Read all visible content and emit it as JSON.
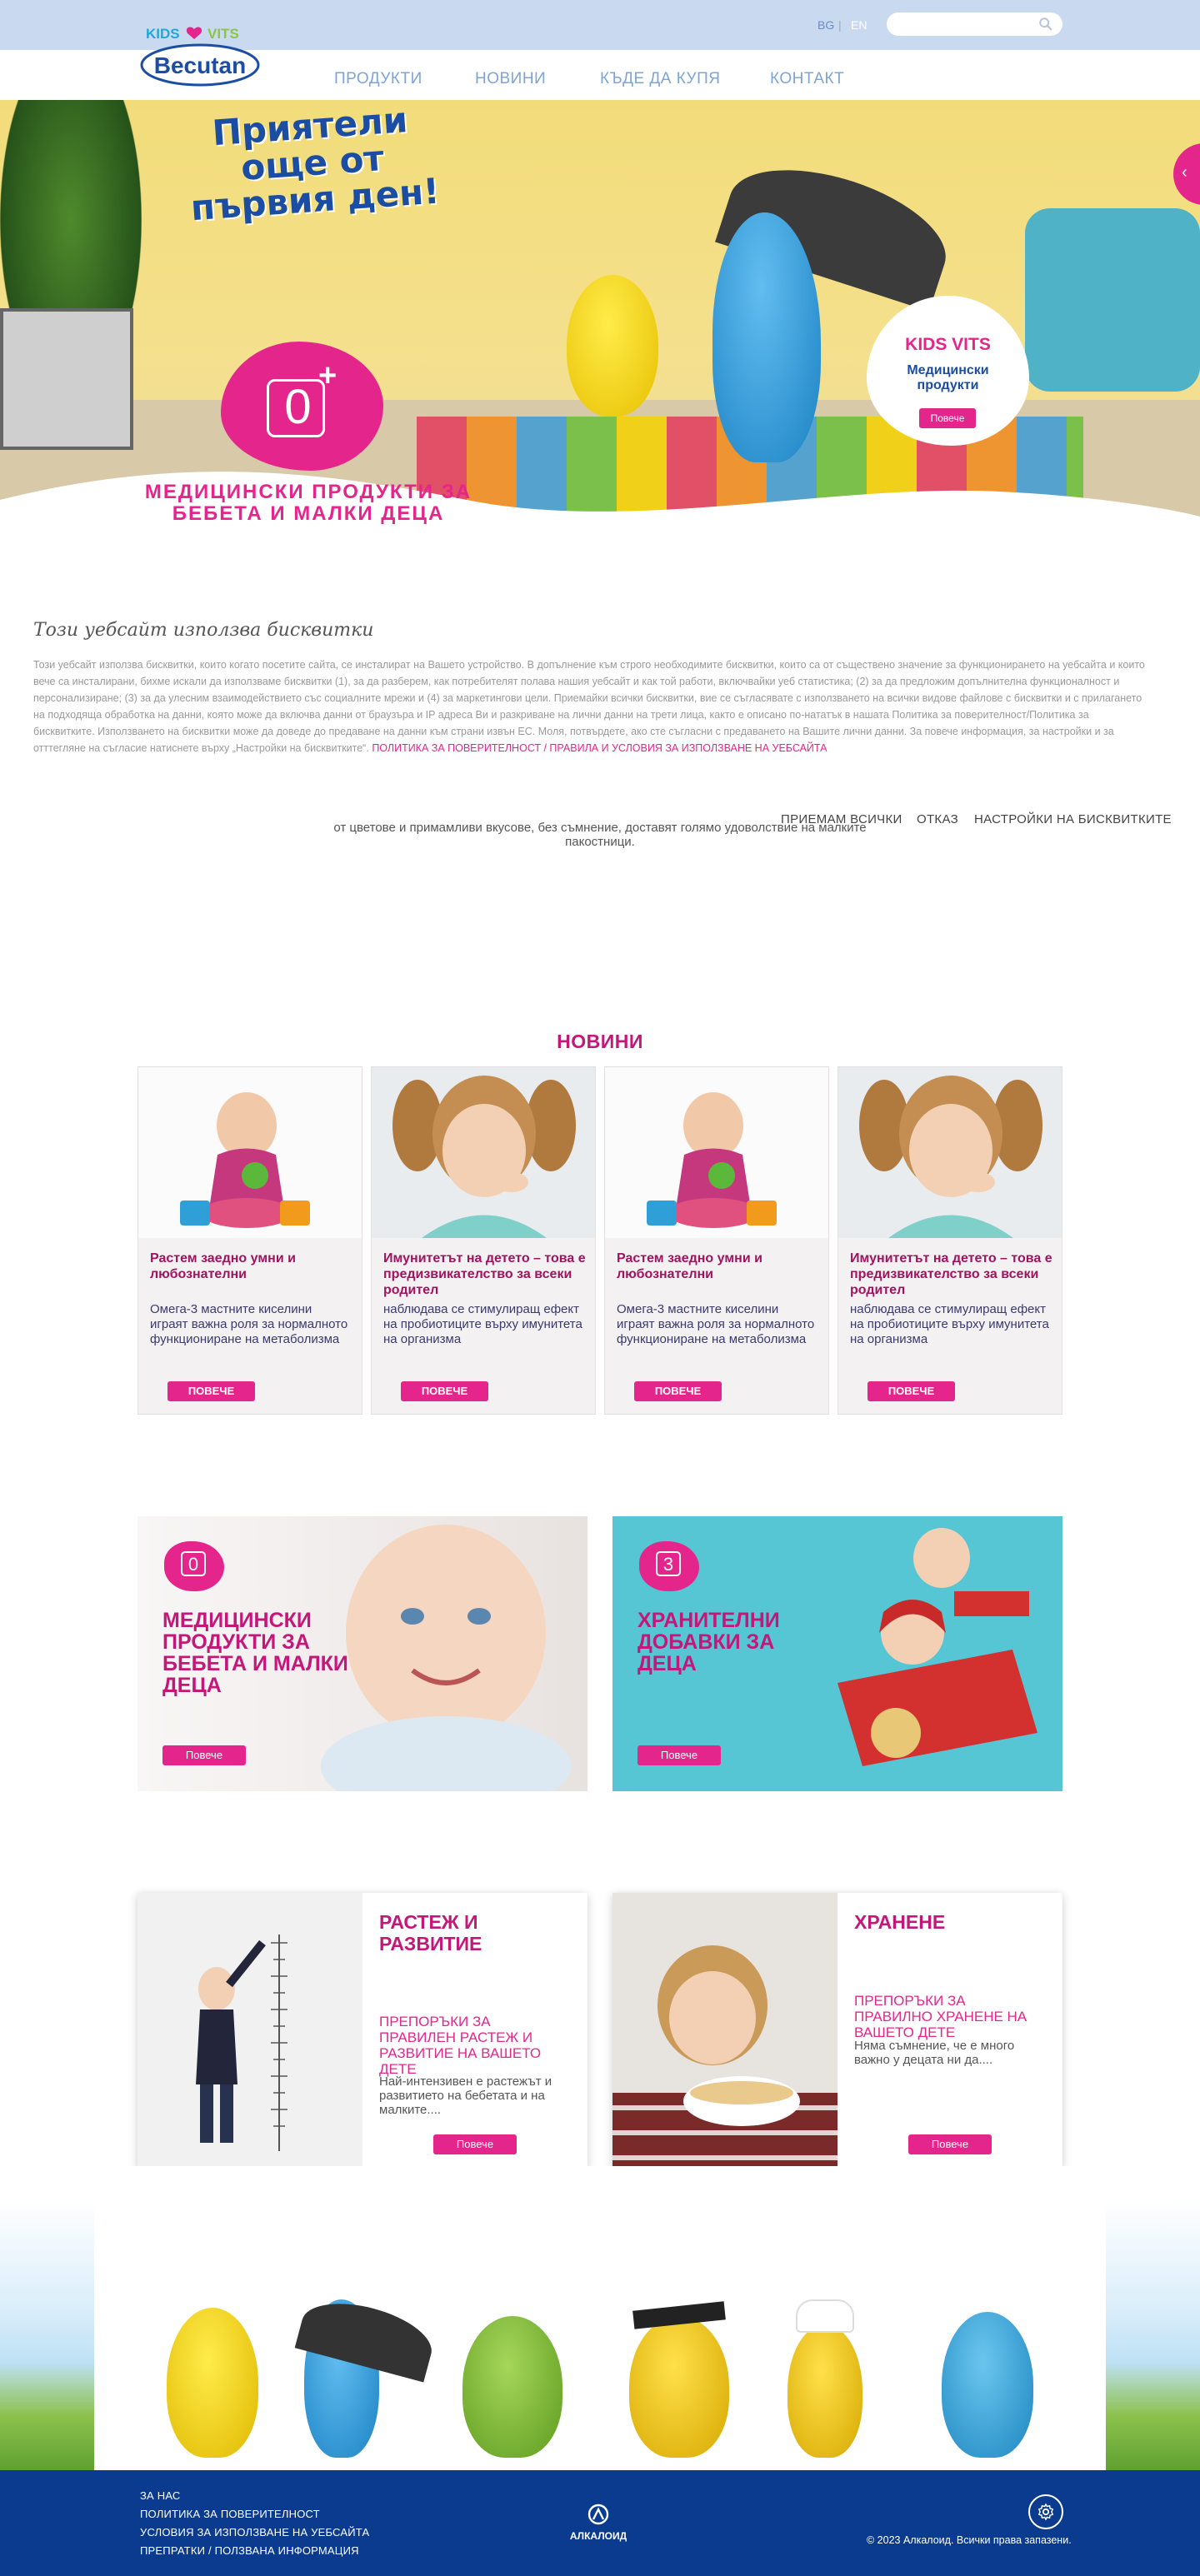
{
  "header": {
    "lang_bg": "BG",
    "lang_sep": "|",
    "lang_en": "EN",
    "search_placeholder": ""
  },
  "logo": {
    "top_text": "KIDS VITS",
    "brand": "Becutan"
  },
  "nav": {
    "products": "ПРОДУКТИ",
    "news": "НОВИНИ",
    "where_to_buy": "КЪДЕ ДА КУПЯ",
    "contact": "КОНТАКТ"
  },
  "hero": {
    "title": "Приятели още от първия ден!",
    "age": "0",
    "age_plus": "+",
    "subtitle": "МЕДИЦИНСКИ ПРОДУКТИ ЗА БЕБЕТА И МАЛКИ ДЕЦА",
    "card_title": "KIDS VITS",
    "card_sub": "Медицински продукти",
    "card_btn": "Повече"
  },
  "cookie": {
    "title": "Този уебсайт използва бисквитки",
    "text": "Този уебсайт използва бисквитки, които когато посетите сайта, се инсталират на Вашето устройство. В допълнение към строго необходимите бисквитки, които са от съществено значение за функционирането на уебсайта и които вече са инсталирани, бихме искали да използваме бисквитки (1), за да разберем, как потребителят полава нашия уебсайт и как той работи, включвайки уеб статистика; (2) за да предложим допълнителна функционалност и персонализиране; (3) за да улесним взаимодействието със социалните мрежи и (4) за маркетингови цели. Приемайки всички бисквитки, вие се съгласявате с използването на всички видове файлове с бисквитки и с прилагането на подходяща обработка на данни, която може да включва данни от браузъра и IP адреса Ви и разкриване на лични данни на трети лица, както е описано по-нататък в нашата Политика за поверителност/Политика за бисквитките. Използването на бисквитки може да доведе до предаване на данни към страни извън ЕС. Моля, потвърдете, ако сте съгласни с предаването на Вашите лични данни. За повече информация, за настройки и за отттегляне на съгласие натиснете върху „Настройки на бисквитките“.",
    "link": "ПОЛИТИКА ЗА ПОВЕРИТЕЛНОСТ / ПРАВИЛА И УСЛОВИЯ ЗА ИЗПОЛЗВАНЕ НА УЕБСАЙТА",
    "accept": "ПРИЕМАМ ВСИЧКИ",
    "reject": "ОТКАЗ",
    "settings": "НАСТРОЙКИ НА БИСКВИТКИТЕ",
    "behind_text": "от цветове и примамливи вкусове, без съмнение, доставят голямо удоволствие на малките пакостници."
  },
  "news": {
    "title": "НОВИНИ",
    "items": [
      {
        "heading": "Растем заедно умни и любознателни",
        "text": "Омега-3 мастните киселини играят важна роля за нормалното функциониране на метаболизма",
        "button": "ПОВЕЧЕ"
      },
      {
        "heading": "Имунитетът на детето – това е предизвикателство за всеки родител",
        "text": "наблюдава се стимулиращ ефект на пробиотиците върху имунитета на организма",
        "button": "ПОВЕЧЕ"
      },
      {
        "heading": "Растем заедно умни и любознателни",
        "text": "Омега-3 мастните киселини играят важна роля за нормалното функциониране на метаболизма",
        "button": "ПОВЕЧЕ"
      },
      {
        "heading": "Имунитетът на детето – това е предизвикателство за всеки родител",
        "text": "наблюдава се стимулиращ ефект на пробиотиците върху имунитета на организма",
        "button": "ПОВЕЧЕ"
      }
    ]
  },
  "promos": [
    {
      "badge": "0",
      "title": "МЕДИЦИНСКИ ПРОДУКТИ ЗА БЕБЕТА И МАЛКИ ДЕЦА",
      "button": "Повече"
    },
    {
      "badge": "3",
      "title": "ХРАНИТЕЛНИ ДОБАВКИ ЗА ДЕЦА",
      "button": "Повече"
    }
  ],
  "features": [
    {
      "title": "РАСТЕЖ И РАЗВИТИЕ",
      "subtitle": "ПРЕПОРЪКИ ЗА ПРАВИЛЕН РАСТЕЖ И РАЗВИТИЕ НА ВАШЕТО ДЕТЕ",
      "text": "Най-интензивен е растежът и развитието на бебетата и на малките....",
      "button": "Повече"
    },
    {
      "title": "ХРАНЕНЕ",
      "subtitle": "ПРЕПОРЪКИ ЗА ПРАВИЛНО ХРАНЕНЕ НА ВАШЕТО ДЕТЕ",
      "text": "Няма съмнение, че е много важно у децата ни да....",
      "button": "Повече"
    }
  ],
  "footer": {
    "links": [
      "ЗА НАС",
      "ПОЛИТИКА ЗА ПОВЕРИТЕЛНОСТ",
      "УСЛОВИЯ ЗА ИЗПОЛЗВАНЕ НА УЕБСАЙТА",
      "ПРЕПРАТКИ / ПОЛЗВАНА ИНФОРМАЦИЯ"
    ],
    "brand": "АЛКАЛОИД",
    "copyright": "© 2023 Алкалоид. Всички права запазени."
  },
  "colors": {
    "accent": "#e4268c",
    "navy": "#0b3b8f",
    "nav_blue": "#7ea4d6",
    "topbar": "#c9daf0"
  }
}
